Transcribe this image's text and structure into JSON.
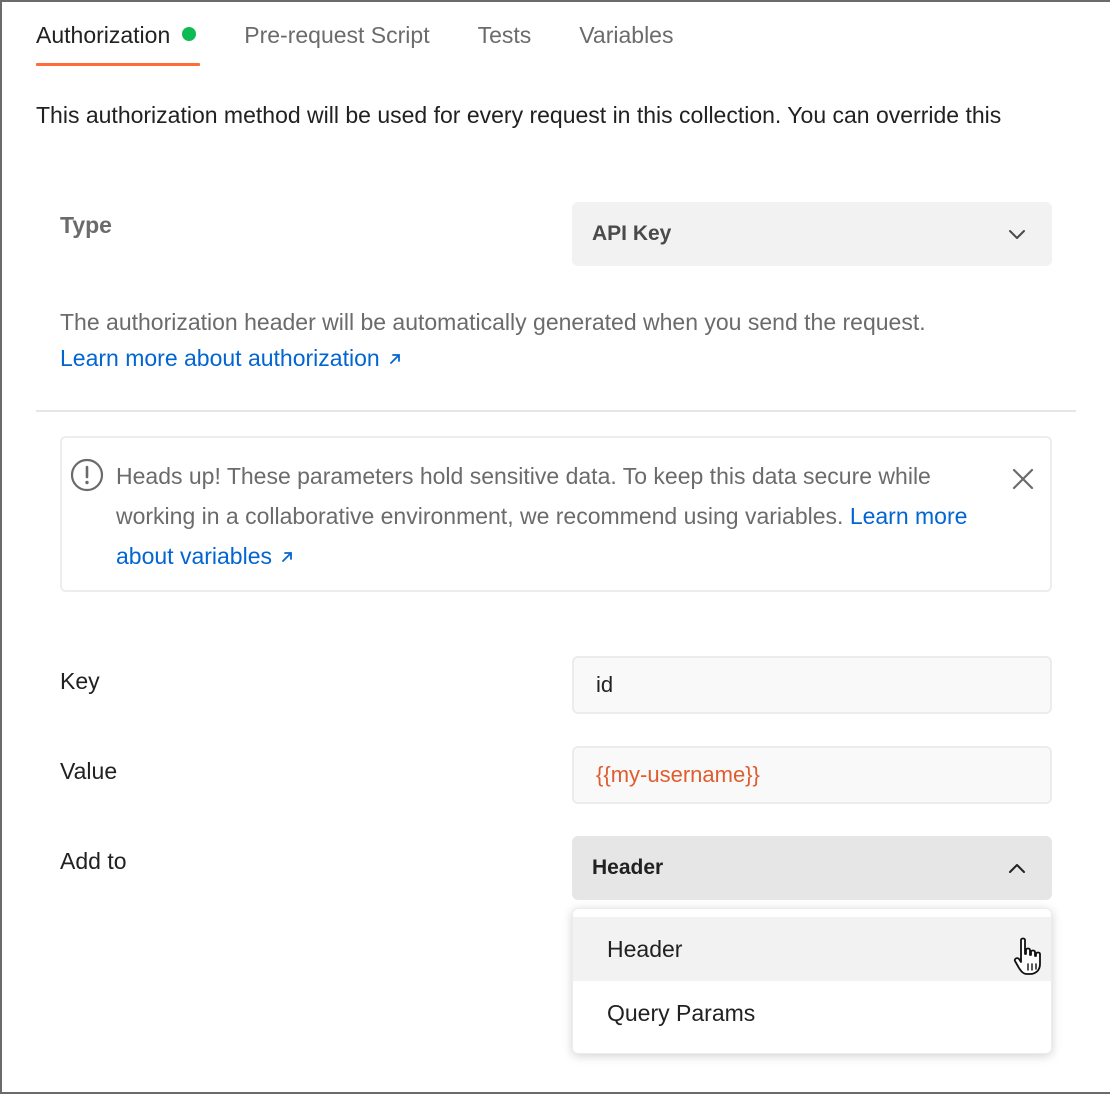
{
  "tabs": [
    {
      "label": "Authorization",
      "active": true,
      "status_dot": "green"
    },
    {
      "label": "Pre-request Script",
      "active": false
    },
    {
      "label": "Tests",
      "active": false
    },
    {
      "label": "Variables",
      "active": false
    }
  ],
  "intro_text": "This authorization method will be used for every request in this collection. You can override this",
  "auth": {
    "type_label": "Type",
    "type_value": "API Key",
    "help_text": "The authorization header will be automatically generated when you send the request.",
    "help_link": "Learn more about authorization"
  },
  "alert": {
    "text": "Heads up! These parameters hold sensitive data. To keep this data secure while working in a collaborative environment, we recommend using variables.",
    "link": "Learn more about variables"
  },
  "fields": {
    "key_label": "Key",
    "key_value": "id",
    "value_label": "Value",
    "value_value": "{{my-username}}",
    "addto_label": "Add to",
    "addto_value": "Header"
  },
  "addto_options": [
    "Header",
    "Query Params"
  ],
  "colors": {
    "accent": "#ff6c37",
    "status_green": "#0cbb52",
    "link": "#0265d2",
    "variable": "#e05c2e"
  },
  "icons": {
    "select_chevron_down": "chevron-down-icon",
    "select_chevron_up": "chevron-up-icon",
    "alert": "exclamation-circle-icon",
    "close": "close-icon",
    "external_link": "arrow-up-right-icon",
    "cursor": "hand-pointer-icon"
  }
}
